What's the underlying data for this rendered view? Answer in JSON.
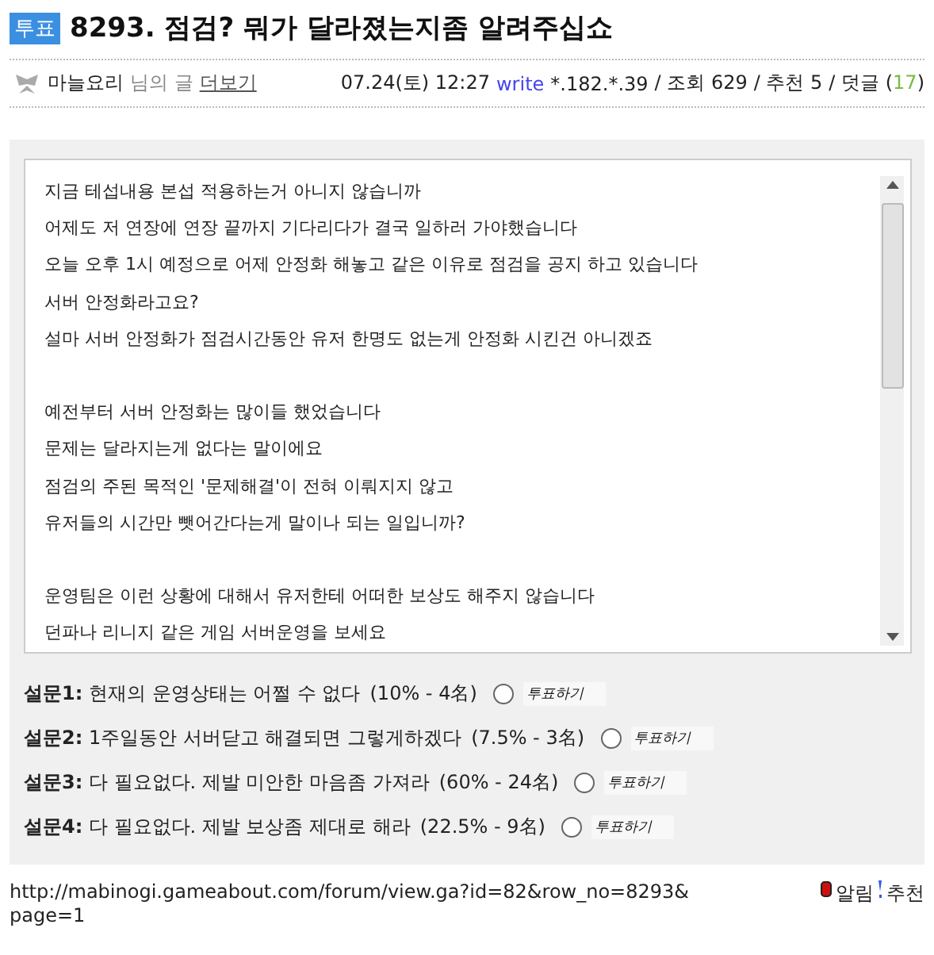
{
  "post": {
    "badge": "투표",
    "title": "8293. 점검? 뭐가 달라졌는지좀 알려주십쇼"
  },
  "meta": {
    "author": "마늘요리",
    "author_suffix": "님의 글",
    "more_link": "더보기",
    "datetime": "07.24(토) 12:27",
    "write_label": "write",
    "ip": "*.182.*.39",
    "views": "/ 조회 629",
    "recommends": "/ 추천 5",
    "comments_label": "/ 덧글 (",
    "comments_count": "17",
    "comments_close": ")"
  },
  "body_paragraphs": [
    [
      "지금 테섭내용 본섭 적용하는거 아니지 않습니까",
      "어제도 저 연장에 연장 끝까지 기다리다가 결국 일하러 가야했습니다",
      "오늘 오후 1시 예정으로 어제 안정화 해놓고 같은 이유로 점검을 공지 하고 있습니다",
      "서버 안정화라고요?",
      "설마 서버 안정화가 점검시간동안 유저 한명도 없는게 안정화 시킨건 아니겠죠"
    ],
    [
      "예전부터 서버 안정화는 많이들 했었습니다",
      "문제는 달라지는게 없다는 말이에요",
      "점검의 주된 목적인 '문제해결'이 전혀 이뤄지지 않고",
      "유저들의 시간만 뺏어간다는게 말이나 되는 일입니까?"
    ],
    [
      "운영팀은 이런 상황에 대해서 유저한테 어떠한 보상도 해주지 않습니다",
      "던파나 리니지 같은 게임 서버운영을 보세요"
    ]
  ],
  "poll": [
    {
      "label": "설문1:",
      "text": "현재의 운영상태는 어쩔 수 없다",
      "result": "(10% - 4名)",
      "selected": false,
      "vote": "투표하기"
    },
    {
      "label": "설문2:",
      "text": "1주일동안 서버닫고 해결되면 그렇게하겠다",
      "result": "(7.5% - 3名)",
      "selected": false,
      "vote": "투표하기"
    },
    {
      "label": "설문3:",
      "text": "다 필요없다. 제발 미안한 마음좀 가져라",
      "result": "(60% - 24名)",
      "selected": false,
      "vote": "투표하기"
    },
    {
      "label": "설문4:",
      "text": "다 필요없다. 제발 보상좀 제대로 해라",
      "result": "(22.5% - 9名)",
      "selected": false,
      "vote": "투표하기"
    }
  ],
  "footer": {
    "url": "http://mabinogi.gameabout.com/forum/view.ga?id=82&row_no=8293&",
    "url_cont": "page=1",
    "alert": "알림",
    "recommend": "추천"
  }
}
